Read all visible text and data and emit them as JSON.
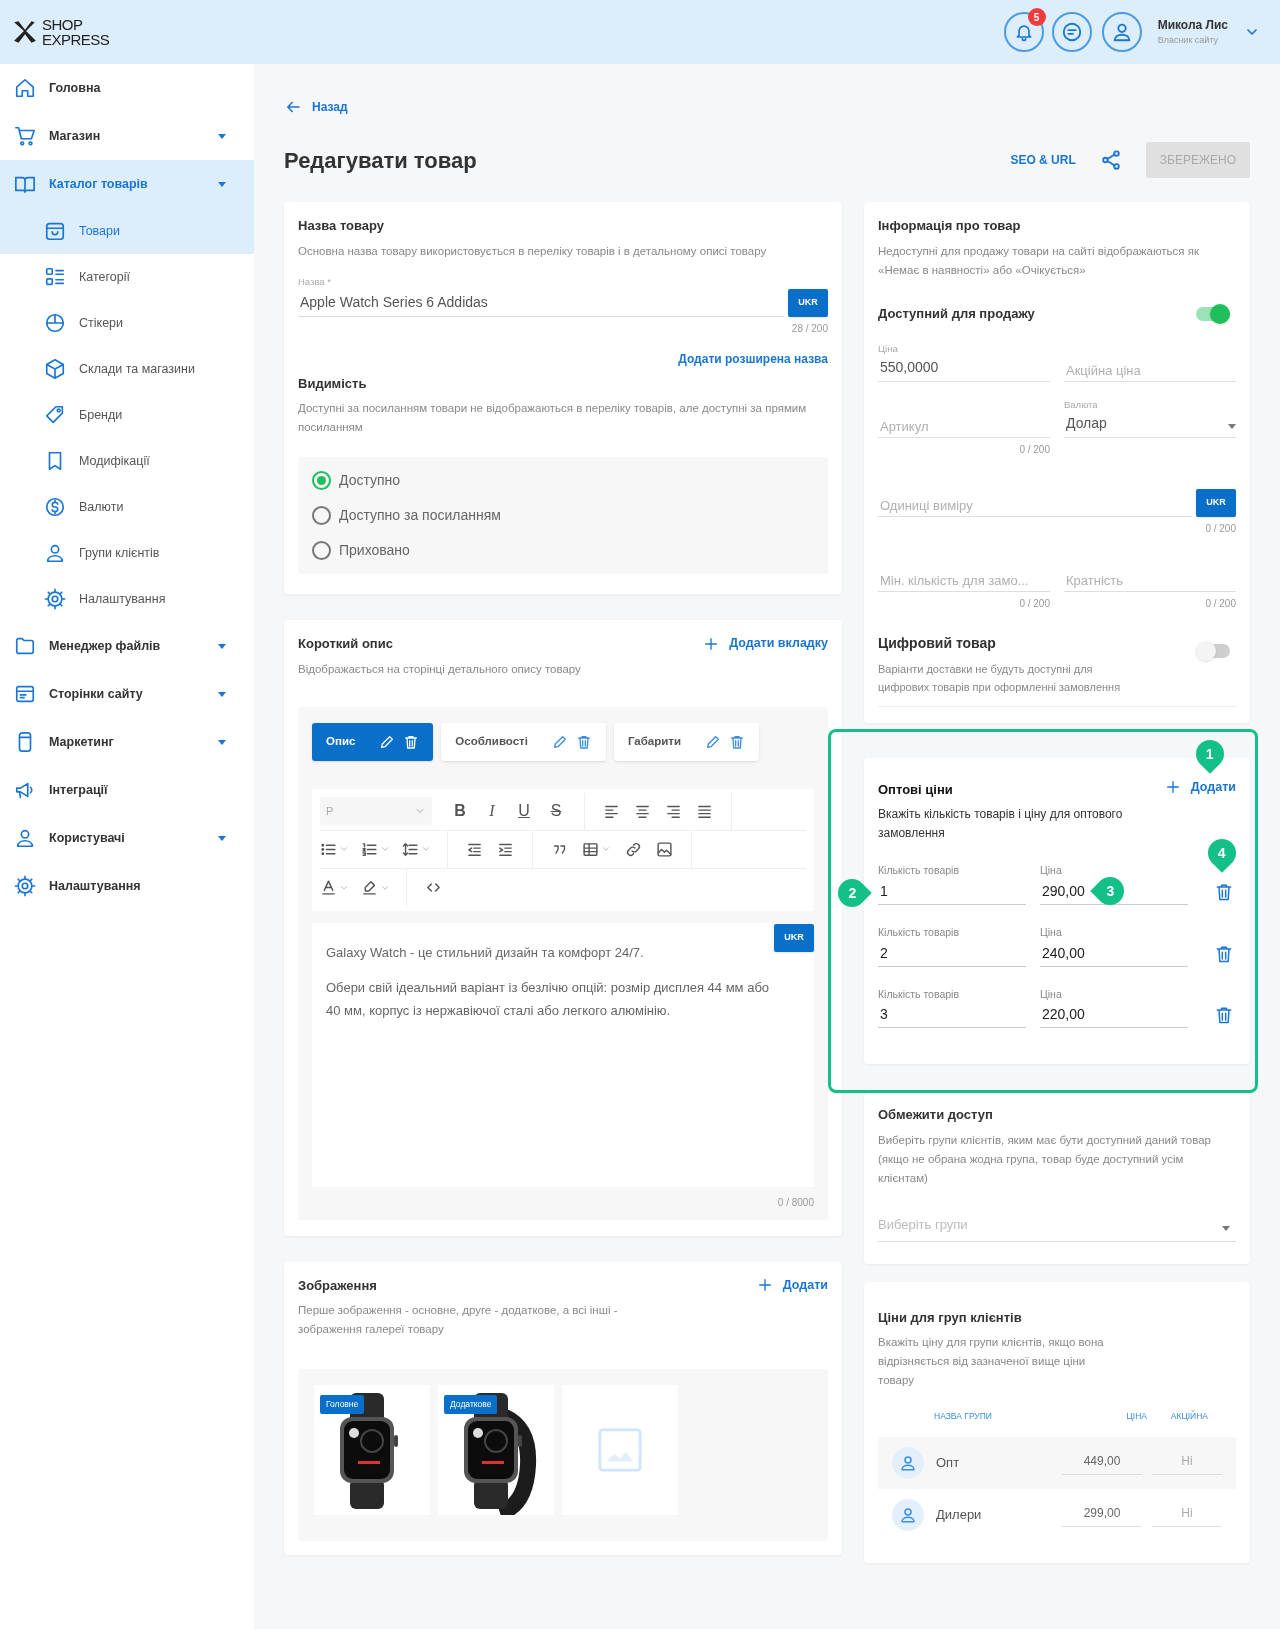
{
  "header": {
    "logo": [
      "SHOP",
      "EXPRESS"
    ],
    "notification_count": "5",
    "user_name": "Микола Лис",
    "user_role": "Власник сайту"
  },
  "sidebar": {
    "items": [
      {
        "label": "Головна",
        "expandable": false,
        "selected": false
      },
      {
        "label": "Магазин",
        "expandable": true,
        "selected": false
      },
      {
        "label": "Каталог товарів",
        "expandable": true,
        "selected": true,
        "children": [
          {
            "label": "Товари",
            "selected": true
          },
          {
            "label": "Категорії",
            "selected": false
          },
          {
            "label": "Стікери",
            "selected": false
          },
          {
            "label": "Склади та магазини",
            "selected": false
          },
          {
            "label": "Бренди",
            "selected": false
          },
          {
            "label": "Модифікації",
            "selected": false
          },
          {
            "label": "Валюти",
            "selected": false
          },
          {
            "label": "Групи клієнтів",
            "selected": false
          },
          {
            "label": "Налаштування",
            "selected": false
          }
        ]
      },
      {
        "label": "Менеджер файлів",
        "expandable": true,
        "selected": false
      },
      {
        "label": "Сторінки сайту",
        "expandable": true,
        "selected": false
      },
      {
        "label": "Маркетинг",
        "expandable": true,
        "selected": false
      },
      {
        "label": "Інтеграції",
        "expandable": false,
        "selected": false
      },
      {
        "label": "Користувачі",
        "expandable": true,
        "selected": false
      },
      {
        "label": "Налаштування",
        "expandable": false,
        "selected": false
      }
    ]
  },
  "back_link": "Назад",
  "page_title": "Редагувати товар",
  "actions": {
    "seo_link": "SEO & URL",
    "save_button": {
      "label": "ЗБЕРЕЖЕНО",
      "disabled": true
    }
  },
  "name_card": {
    "title": "Назва товару",
    "description": "Основна назва товару використовується в переліку товарів і в детальному описі товару",
    "field_label": "Назва *",
    "value": "Apple Watch Series 6 Addidas",
    "language": "UKR",
    "counter": "28 / 200",
    "extended_name_link": "Додати розширена назва",
    "visibility": {
      "title": "Видимість",
      "description": "Доступні за посиланням товари не відображаються в переліку товарів, але доступні за прямим посиланням",
      "options": [
        {
          "label": "Доступно",
          "selected": true
        },
        {
          "label": "Доступно за посиланням",
          "selected": false
        },
        {
          "label": "Приховано",
          "selected": false
        }
      ]
    }
  },
  "short_description": {
    "title": "Короткий опис",
    "description": "Відображається на сторінці детального опису товару",
    "add_tab": "Додати вкладку",
    "tabs": [
      {
        "label": "Опис",
        "selected": true
      },
      {
        "label": "Особливості",
        "selected": false
      },
      {
        "label": "Габарити",
        "selected": false
      }
    ],
    "format": "P",
    "style_buttons": [
      "B",
      "I",
      "U",
      "S"
    ],
    "language": "UKR",
    "paragraphs": [
      "Galaxy Watch - це стильний дизайн та комфорт 24/7.",
      "Обери свій ідеальний варіант із безлічю опцій: розмір дисплея 44 мм або 40 мм, корпус із нержавіючої сталі або легкого алюмінію."
    ],
    "counter": "0 / 8000"
  },
  "images": {
    "title": "Зображення",
    "description": "Перше зображення - основне, друге - додаткове, а всі інші - зображення галереї товару",
    "add": "Додати",
    "items": [
      {
        "kind": "picture",
        "badge": "Головне"
      },
      {
        "kind": "picture",
        "badge": "Додаткове"
      },
      {
        "kind": "empty"
      }
    ]
  },
  "product_info": {
    "title": "Інформація про товар",
    "description": "Недоступні для продажу товари на сайті відображаються як «Немає в наявності» або «Очікується»",
    "available": {
      "label": "Доступний для продажу",
      "on": true
    },
    "price": {
      "label": "Ціна",
      "value": "550,0000"
    },
    "sale_price": {
      "placeholder": "Акційна ціна"
    },
    "article": {
      "placeholder": "Артикул",
      "counter": "0 / 200"
    },
    "currency": {
      "label": "Валюта",
      "value": "Долар"
    },
    "units": {
      "placeholder": "Одиниці виміру",
      "language": "UKR",
      "counter": "0 / 200"
    },
    "min_quantity": {
      "placeholder": "Мін. кількість для замо...",
      "counter": "0 / 200"
    },
    "multiplicity": {
      "placeholder": "Кратність",
      "counter": "0 / 200"
    },
    "digital": {
      "title": "Цифровий товар",
      "description": "Варіанти доставки не будуть доступні для цифрових товарів при оформленні замовлення",
      "on": false
    }
  },
  "wholesale": {
    "title": "Оптові ціни",
    "add": "Додати",
    "description": "Вкажіть кількість товарів і ціну для оптового замовлення",
    "rows": [
      {
        "quantity_label": "Кількість товарів",
        "quantity": "1",
        "price_label": "Ціна",
        "price": "290,00"
      },
      {
        "quantity_label": "Кількість товарів",
        "quantity": "2",
        "price_label": "Ціна",
        "price": "240,00"
      },
      {
        "quantity_label": "Кількість товарів",
        "quantity": "3",
        "price_label": "Ціна",
        "price": "220,00"
      }
    ],
    "annotations": [
      {
        "label": "1"
      },
      {
        "label": "2"
      },
      {
        "label": "3"
      },
      {
        "label": "4"
      }
    ]
  },
  "restrict_access": {
    "title": "Обмежити доступ",
    "description": "Виберіть групи клієнтів, яким має бути доступний даний товар (якщо не обрана жодна група, товар буде доступний усім клієнтам)",
    "placeholder": "Виберіть групи"
  },
  "group_prices": {
    "title": "Ціни для груп клієнтів",
    "description": "Вкажіть ціну для групи клієнтів, якщо вона відрізняється від зазначеної вище ціни товару",
    "columns": [
      "НАЗВА ГРУПИ",
      "ЦІНА",
      "АКЦІЙНА"
    ],
    "rows": [
      {
        "name": "Опт",
        "price": "449,00",
        "sale": "Ні"
      },
      {
        "name": "Дилери",
        "price": "299,00",
        "sale": "Ні"
      }
    ]
  }
}
